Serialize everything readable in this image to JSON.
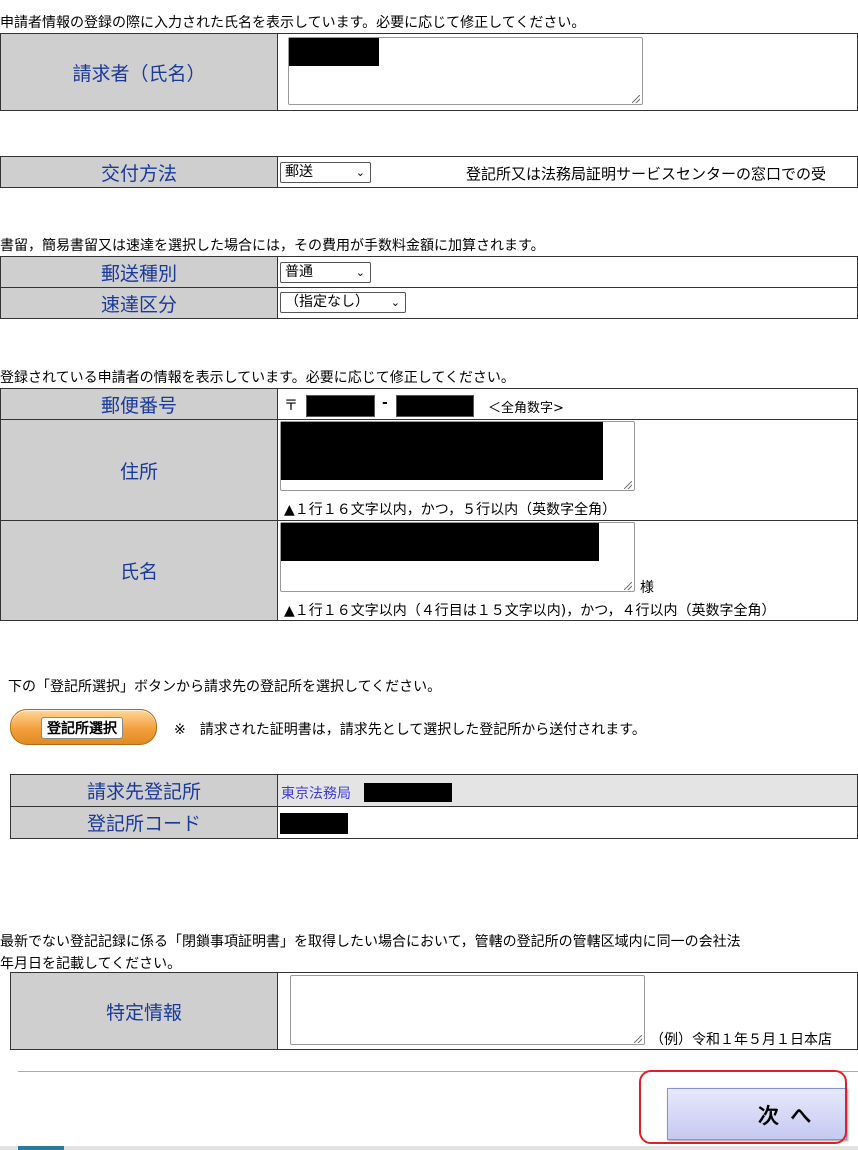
{
  "requester": {
    "note": "申請者情報の登録の際に入力された氏名を表示しています。必要に応じて修正してください。",
    "label": "請求者（氏名）"
  },
  "delivery": {
    "label": "交付方法",
    "selected": "郵送",
    "side_note": "登記所又は法務局証明サービスセンターの窓口での受"
  },
  "mail": {
    "note": "書留，簡易書留又は速達を選択した場合には，その費用が手数料金額に加算されます。",
    "type_label": "郵送種別",
    "type_selected": "普通",
    "express_label": "速達区分",
    "express_selected": "（指定なし）"
  },
  "applicant": {
    "note": "登録されている申請者の情報を表示しています。必要に応じて修正してください。",
    "postal_label": "郵便番号",
    "postal_mark": "〒",
    "postal_dash": "-",
    "postal_hint": "＜全角数字>",
    "address_label": "住所",
    "address_hint": "▲１行１６文字以内，かつ，５行以内（英数字全角）",
    "name_label": "氏名",
    "name_suffix": "様",
    "name_hint": "▲１行１６文字以内（４行目は１５文字以内)，かつ，４行以内（英数字全角）"
  },
  "registry": {
    "instruction": "下の「登記所選択」ボタンから請求先の登記所を選択してください。",
    "select_button": "登記所選択",
    "button_note": "※　請求された証明書は，請求先として選択した登記所から送付されます。",
    "office_label": "請求先登記所",
    "office_value": "東京法務局",
    "code_label": "登記所コード"
  },
  "specific": {
    "note1": "最新でない登記記録に係る「閉鎖事項証明書」を取得したい場合において，管轄の登記所の管轄区域内に同一の会社法",
    "note2": "年月日を記載してください。",
    "label": "特定情報",
    "example": "（例）令和１年５月１日本店"
  },
  "footer": {
    "next_button": "次 へ"
  }
}
